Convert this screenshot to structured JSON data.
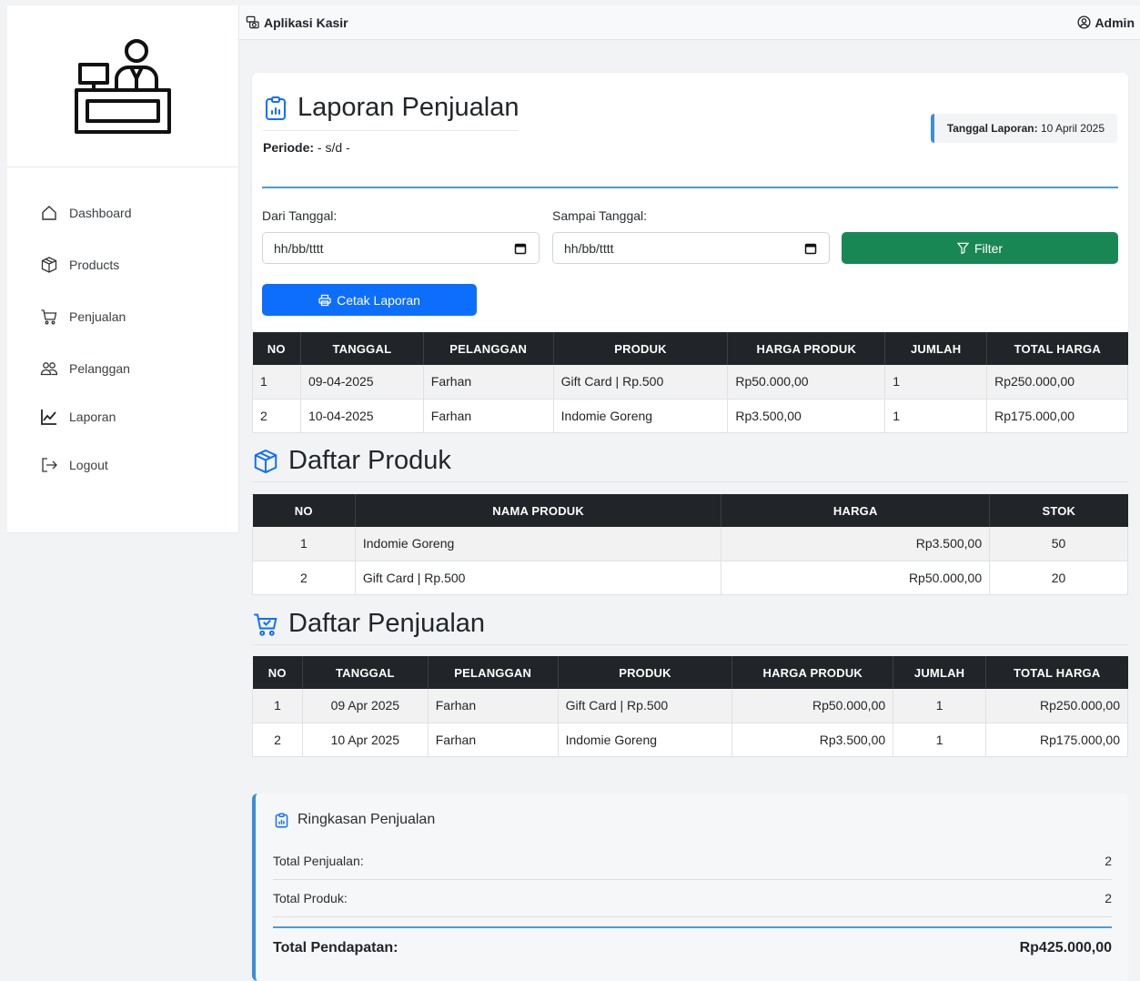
{
  "navbar": {
    "brand": "Aplikasi Kasir",
    "user": "Admin"
  },
  "sidebar": {
    "items": [
      {
        "label": "Dashboard",
        "icon": "house-icon"
      },
      {
        "label": "Products",
        "icon": "box-icon"
      },
      {
        "label": "Penjualan",
        "icon": "cart-icon"
      },
      {
        "label": "Pelanggan",
        "icon": "people-icon"
      },
      {
        "label": "Laporan",
        "icon": "graph-icon"
      },
      {
        "label": "Logout",
        "icon": "logout-icon"
      }
    ]
  },
  "report": {
    "title": "Laporan Penjualan",
    "periode_label": "Periode:",
    "periode_value": "- s/d -",
    "date_label": "Tanggal Laporan:",
    "date_value": "10 April 2025",
    "from_label": "Dari Tanggal:",
    "to_label": "Sampai Tanggal:",
    "from_placeholder": "hh/bb/tttt",
    "to_placeholder": "hh/bb/tttt",
    "filter_label": "Filter",
    "print_label": "Cetak Laporan",
    "columns": [
      "NO",
      "TANGGAL",
      "PELANGGAN",
      "PRODUK",
      "HARGA PRODUK",
      "JUMLAH",
      "TOTAL HARGA"
    ],
    "rows": [
      [
        "1",
        "09-04-2025",
        "Farhan",
        "Gift Card | Rp.500",
        "Rp50.000,00",
        "1",
        "Rp250.000,00"
      ],
      [
        "2",
        "10-04-2025",
        "Farhan",
        "Indomie Goreng",
        "Rp3.500,00",
        "1",
        "Rp175.000,00"
      ]
    ]
  },
  "products": {
    "title": "Daftar Produk",
    "columns": [
      "NO",
      "NAMA PRODUK",
      "HARGA",
      "STOK"
    ],
    "rows": [
      [
        "1",
        "Indomie Goreng",
        "Rp3.500,00",
        "50"
      ],
      [
        "2",
        "Gift Card | Rp.500",
        "Rp50.000,00",
        "20"
      ]
    ]
  },
  "sales": {
    "title": "Daftar Penjualan",
    "columns": [
      "NO",
      "TANGGAL",
      "PELANGGAN",
      "PRODUK",
      "HARGA PRODUK",
      "JUMLAH",
      "TOTAL HARGA"
    ],
    "rows": [
      [
        "1",
        "09 Apr 2025",
        "Farhan",
        "Gift Card | Rp.500",
        "Rp50.000,00",
        "1",
        "Rp250.000,00"
      ],
      [
        "2",
        "10 Apr 2025",
        "Farhan",
        "Indomie Goreng",
        "Rp3.500,00",
        "1",
        "Rp175.000,00"
      ]
    ]
  },
  "summary": {
    "title": "Ringkasan Penjualan",
    "total_sales_label": "Total Penjualan:",
    "total_sales_value": "2",
    "total_products_label": "Total Produk:",
    "total_products_value": "2",
    "revenue_label": "Total Pendapatan:",
    "revenue_value": "Rp425.000,00"
  },
  "colors": {
    "accent_blue": "#0d6efd",
    "filter_green": "#198754",
    "table_header": "#212529",
    "info_border": "#3a8fd6"
  }
}
